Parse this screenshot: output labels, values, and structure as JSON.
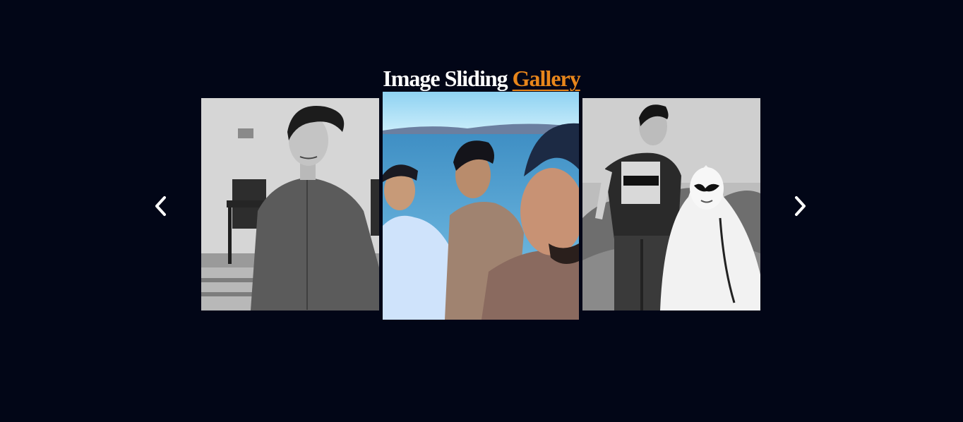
{
  "gallery": {
    "title_main": "Image Sliding",
    "title_accent": "Gallery",
    "accent_color": "#e8861b",
    "background_color": "#020617",
    "prev_icon": "chevron-left-icon",
    "next_icon": "chevron-right-icon",
    "slides": [
      {
        "name": "photo-portrait-bw",
        "style": "grayscale"
      },
      {
        "name": "photo-group-lake",
        "style": "color"
      },
      {
        "name": "photo-ghost-costume-bw",
        "style": "grayscale"
      }
    ]
  }
}
